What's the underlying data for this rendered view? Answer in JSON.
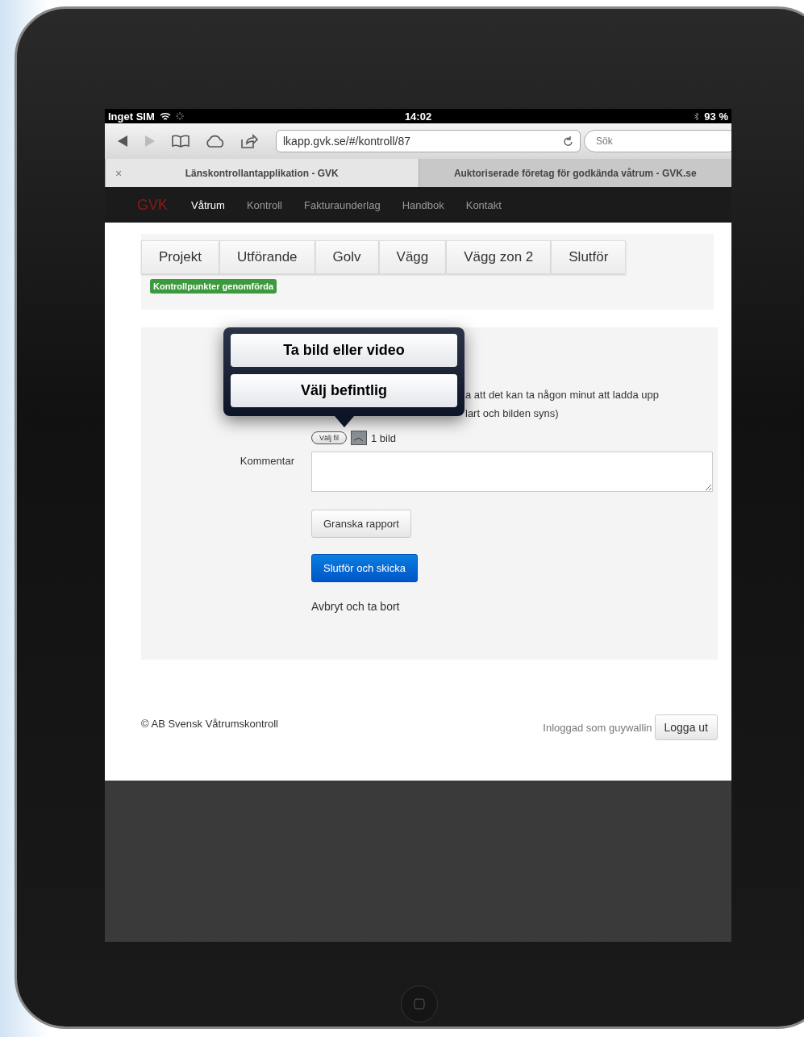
{
  "status_bar": {
    "carrier": "Inget SIM",
    "time": "14:02",
    "battery": "93 %"
  },
  "browser": {
    "url": "lkapp.gvk.se/#/kontroll/87",
    "search_placeholder": "Sök",
    "close_tab": "×",
    "tabs": [
      {
        "title": "Länskontrollantapplikation - GVK",
        "selected": true
      },
      {
        "title": "Auktoriserade företag för godkända våtrum - GVK.se",
        "selected": false
      }
    ]
  },
  "nav": {
    "logo": "GVK",
    "items": [
      {
        "label": "Våtrum",
        "selected": true
      },
      {
        "label": "Kontroll",
        "selected": false
      },
      {
        "label": "Fakturaunderlag",
        "selected": false
      },
      {
        "label": "Handbok",
        "selected": false
      },
      {
        "label": "Kontakt",
        "selected": false
      }
    ]
  },
  "steps": [
    "Projekt",
    "Utförande",
    "Golv",
    "Vägg",
    "Vägg zon 2",
    "Slutför"
  ],
  "badge": "Kontrollpunkter genomförda",
  "popover": {
    "options": [
      "Ta bild eller video",
      "Välj befintlig"
    ]
  },
  "help_lines": [
    "a att det kan ta någon minut att ladda upp",
    "lart och bilden syns)"
  ],
  "file_button": "Välj fil",
  "file_count": "1 bild",
  "comment": {
    "label": "Kommentar"
  },
  "review_button": "Granska rapport",
  "submit_button": "Slutför och skicka",
  "cancel_link": "Avbryt och ta bort",
  "footer": {
    "copyright": "© AB Svensk Våtrumskontroll",
    "logged_in": "Inloggad som guywallin",
    "logout_button": "Logga ut"
  }
}
